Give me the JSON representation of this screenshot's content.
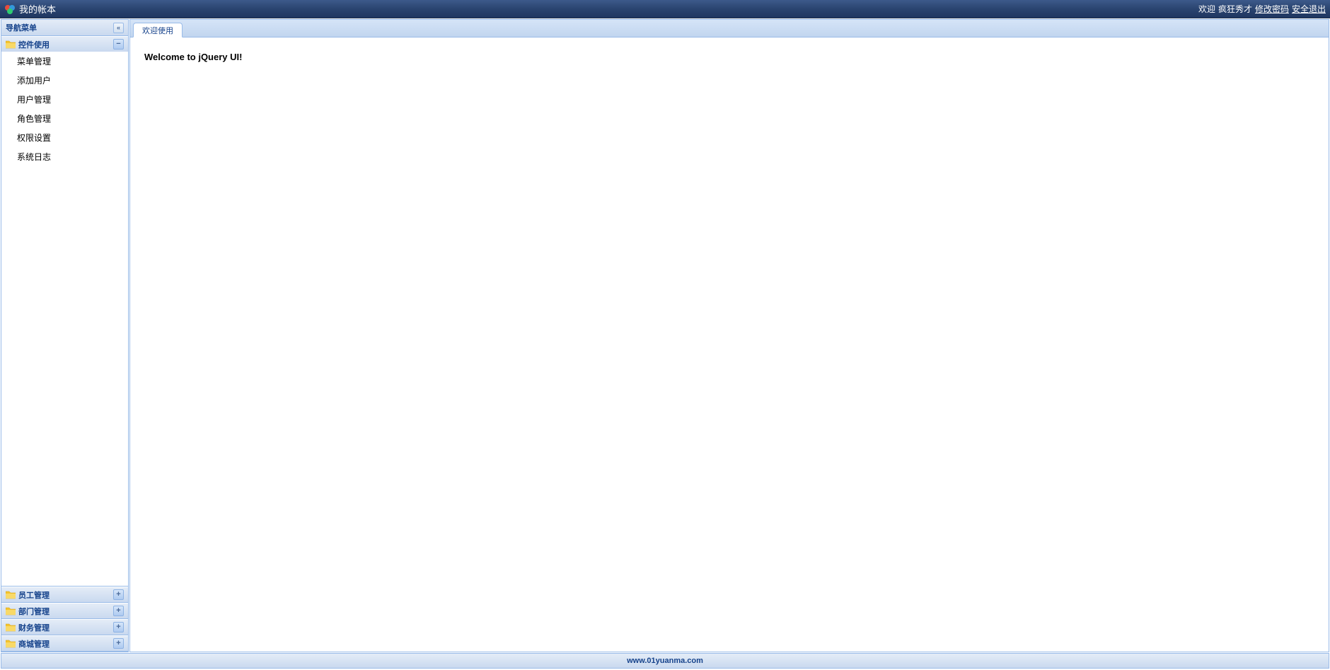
{
  "header": {
    "title": "我的帐本",
    "welcome_prefix": "欢迎",
    "username": "疯狂秀才",
    "change_password": "修改密码",
    "logout": "安全退出"
  },
  "sidebar": {
    "title": "导航菜单",
    "panels": [
      {
        "title": "控件使用",
        "expanded": true,
        "items": [
          "菜单管理",
          "添加用户",
          "用户管理",
          "角色管理",
          "权限设置",
          "系统日志"
        ]
      },
      {
        "title": "员工管理",
        "expanded": false,
        "items": []
      },
      {
        "title": "部门管理",
        "expanded": false,
        "items": []
      },
      {
        "title": "财务管理",
        "expanded": false,
        "items": []
      },
      {
        "title": "商城管理",
        "expanded": false,
        "items": []
      }
    ]
  },
  "tabs": [
    {
      "label": "欢迎使用",
      "active": true
    }
  ],
  "content": {
    "welcome": "Welcome to jQuery UI!"
  },
  "footer": {
    "text": "www.01yuanma.com"
  }
}
